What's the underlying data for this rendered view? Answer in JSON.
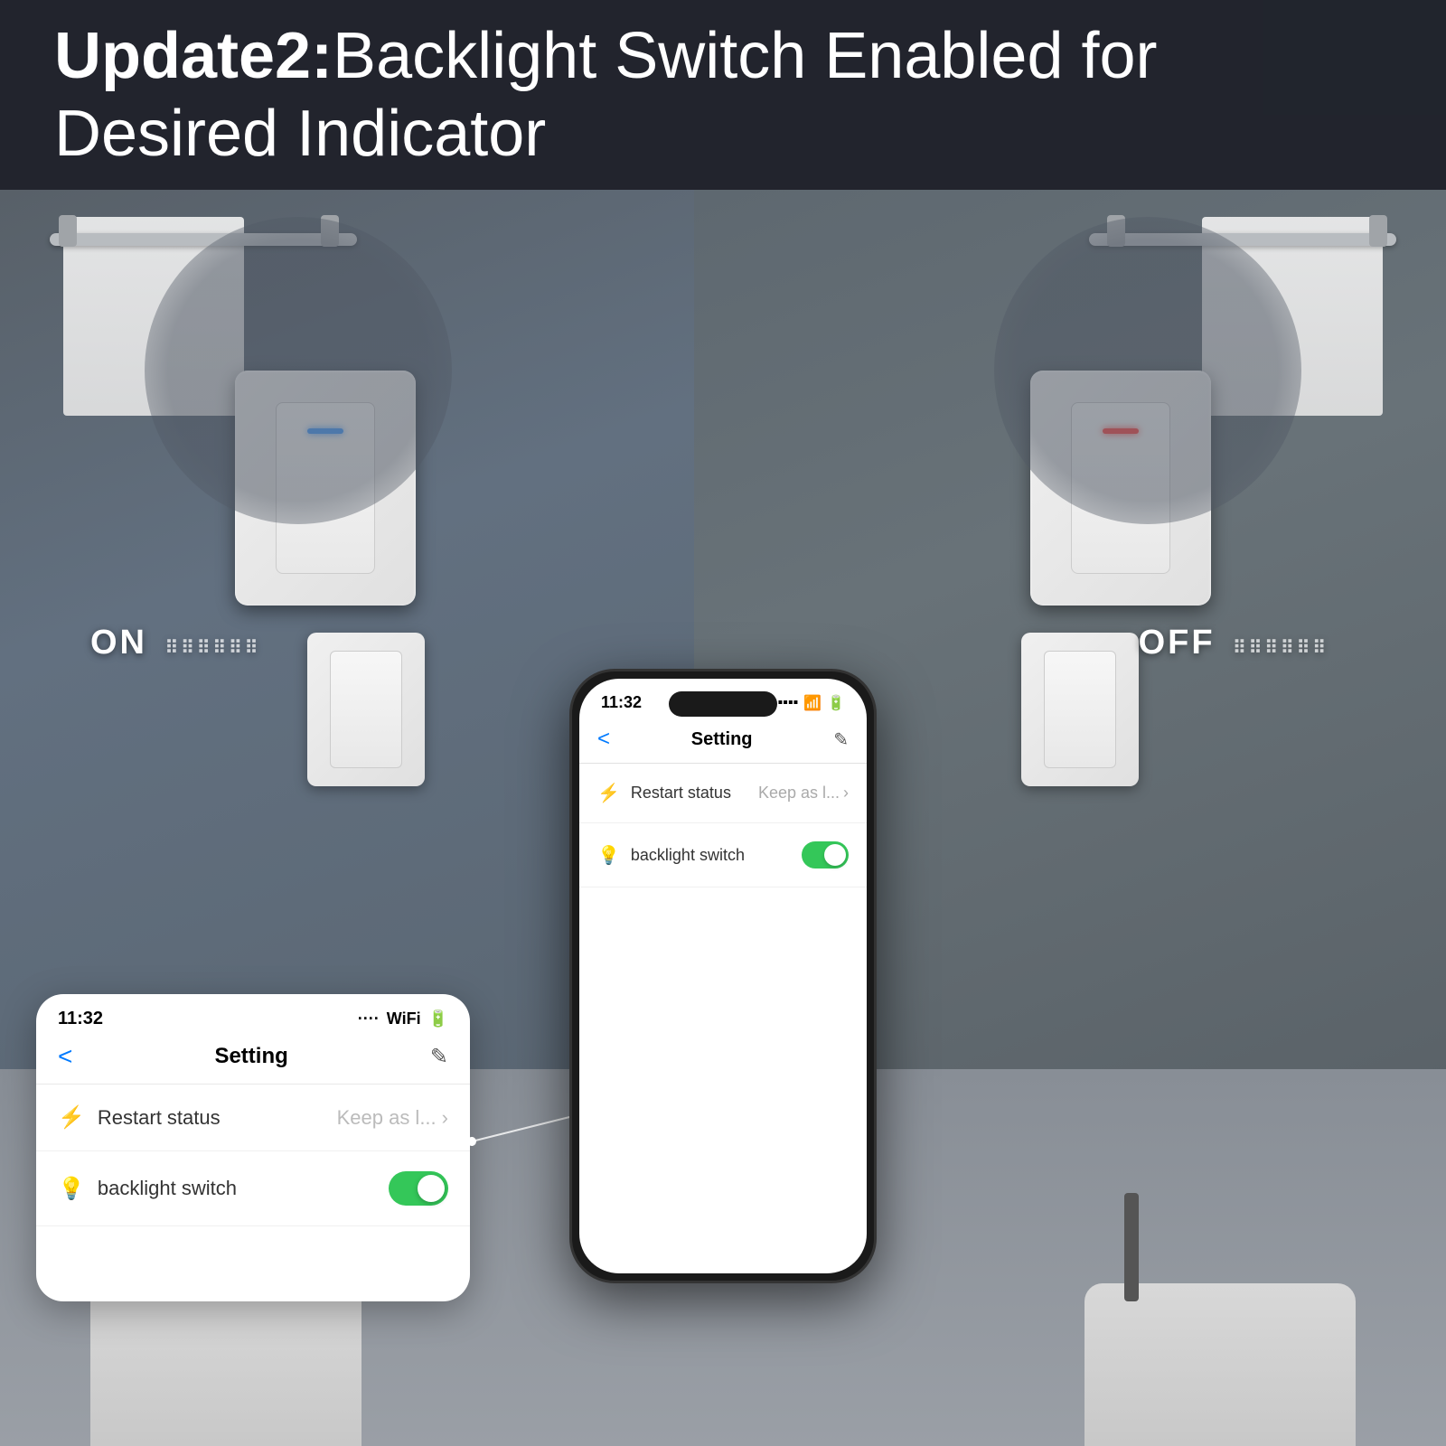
{
  "header": {
    "title_bold": "Update2:",
    "title_rest": "Backlight Switch Enabled for Desired Indicator"
  },
  "left_panel": {
    "state": "ON",
    "indicator_color": "blue"
  },
  "right_panel": {
    "state": "OFF",
    "indicator_color": "red"
  },
  "phone_large": {
    "status_time": "11:32",
    "header_title": "Setting",
    "back_label": "<",
    "edit_icon": "✎",
    "rows": [
      {
        "icon": "⚡",
        "label": "Restart status",
        "value": "Keep as l...",
        "has_chevron": true
      },
      {
        "icon": "💡",
        "label": "backlight switch",
        "value": "",
        "has_toggle": true,
        "toggle_on": true
      }
    ]
  },
  "app_card": {
    "status_time": "11:32",
    "header_title": "Setting",
    "back_label": "<",
    "edit_icon": "✎",
    "rows": [
      {
        "icon": "⚡",
        "label": "Restart status",
        "value": "Keep as l...",
        "has_chevron": true
      },
      {
        "icon": "💡",
        "label": "backlight switch",
        "value": "",
        "has_toggle": true,
        "toggle_on": true
      }
    ]
  },
  "colors": {
    "header_bg": "#1e2128",
    "toggle_on": "#34c759",
    "indicator_blue": "#4a9eff",
    "indicator_red": "#ff4a4a",
    "switch_plate": "#f0f0f0",
    "scene_bg": "#5a6370"
  }
}
